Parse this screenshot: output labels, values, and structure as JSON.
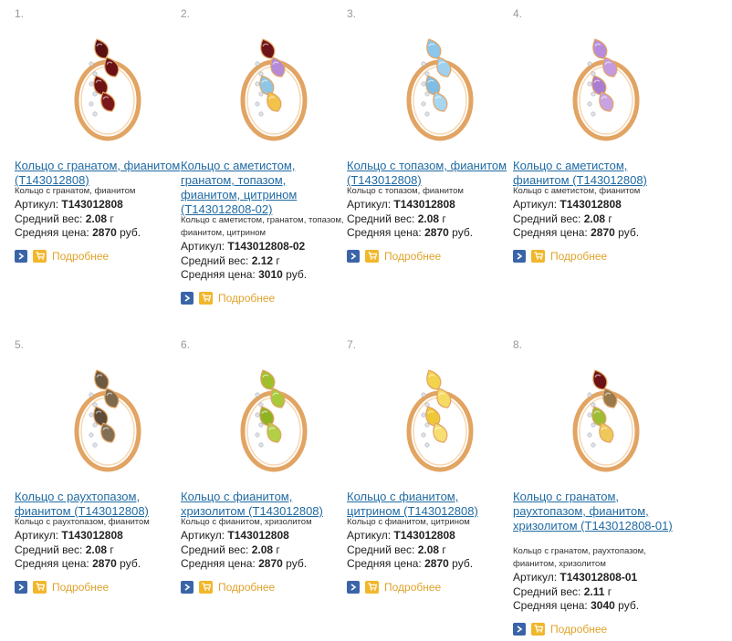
{
  "products": [
    {
      "number": "1.",
      "title": "Кольцо с гранатом, фианитом (Т143012808)",
      "description": "Кольцо с гранатом, фианитом",
      "article_label": "Артикул:",
      "article": "Т143012808",
      "weight_label": "Средний вес:",
      "weight": "2.08",
      "weight_unit": "г",
      "price_label": "Средняя цена:",
      "price": "2870",
      "price_unit": "руб.",
      "more_label": "Подробнее",
      "stones": [
        "#5a0f12",
        "#6b1115",
        "#6e1216",
        "#7b171a"
      ]
    },
    {
      "number": "2.",
      "title": "Кольцо с аметистом, гранатом, топазом, фианитом, цитрином (Т143012808-02)",
      "description": "Кольцо с аметистом, гранатом, топазом, фианитом, цитрином",
      "article_label": "Артикул:",
      "article": "Т143012808-02",
      "weight_label": "Средний вес:",
      "weight": "2.12",
      "weight_unit": "г",
      "price_label": "Средняя цена:",
      "price": "3010",
      "price_unit": "руб.",
      "more_label": "Подробнее",
      "stones": [
        "#6e1318",
        "#b58ad6",
        "#8fc6e6",
        "#f2c24a"
      ]
    },
    {
      "number": "3.",
      "title": "Кольцо с топазом, фианитом (Т143012808)",
      "description": "Кольцо с топазом, фианитом",
      "article_label": "Артикул:",
      "article": "Т143012808",
      "weight_label": "Средний вес:",
      "weight": "2.08",
      "weight_unit": "г",
      "price_label": "Средняя цена:",
      "price": "2870",
      "price_unit": "руб.",
      "more_label": "Подробнее",
      "stones": [
        "#8cc6ea",
        "#9fd1ef",
        "#7fbde6",
        "#a7d6f0"
      ]
    },
    {
      "number": "4.",
      "title": "Кольцо с аметистом, фианитом (Т143012808)",
      "description": "Кольцо с аметистом, фианитом",
      "article_label": "Артикул:",
      "article": "Т143012808",
      "weight_label": "Средний вес:",
      "weight": "2.08",
      "weight_unit": "г",
      "price_label": "Средняя цена:",
      "price": "2870",
      "price_unit": "руб.",
      "more_label": "Подробнее",
      "stones": [
        "#b78ddb",
        "#c49be0",
        "#a97dd2",
        "#c7a3e2"
      ]
    },
    {
      "number": "5.",
      "title": "Кольцо с раухтопазом, фианитом (Т143012808)",
      "description": "Кольцо с раухтопазом, фианитом",
      "article_label": "Артикул:",
      "article": "Т143012808",
      "weight_label": "Средний вес:",
      "weight": "2.08",
      "weight_unit": "г",
      "price_label": "Средняя цена:",
      "price": "2870",
      "price_unit": "руб.",
      "more_label": "Подробнее",
      "stones": [
        "#6d5a42",
        "#7d6a4f",
        "#5e4c38",
        "#826f55"
      ]
    },
    {
      "number": "6.",
      "title": "Кольцо с фианитом, хризолитом (Т143012808)",
      "description": "Кольцо с фианитом, хризолитом",
      "article_label": "Артикул:",
      "article": "Т143012808",
      "weight_label": "Средний вес:",
      "weight": "2.08",
      "weight_unit": "г",
      "price_label": "Средняя цена:",
      "price": "2870",
      "price_unit": "руб.",
      "more_label": "Подробнее",
      "stones": [
        "#9fbf2c",
        "#a9c93a",
        "#90b324",
        "#b2cf47"
      ]
    },
    {
      "number": "7.",
      "title": "Кольцо с фианитом, цитрином (Т143012808)",
      "description": "Кольцо с фианитом, цитрином",
      "article_label": "Артикул:",
      "article": "Т143012808",
      "weight_label": "Средний вес:",
      "weight": "2.08",
      "weight_unit": "г",
      "price_label": "Средняя цена:",
      "price": "2870",
      "price_unit": "руб.",
      "more_label": "Подробнее",
      "stones": [
        "#f3d24c",
        "#f5da63",
        "#eec838",
        "#f6de72"
      ]
    },
    {
      "number": "8.",
      "title": "Кольцо с гранатом, раухтопазом, фианитом, хризолитом (Т143012808-01)",
      "description": "Кольцо с гранатом, раухтопазом, фианитом, хризолитом",
      "article_label": "Артикул:",
      "article": "Т143012808-01",
      "weight_label": "Средний вес:",
      "weight": "2.11",
      "weight_unit": "г",
      "price_label": "Средняя цена:",
      "price": "3040",
      "price_unit": "руб.",
      "more_label": "Подробнее",
      "stones": [
        "#6b1216",
        "#9a7a4d",
        "#9cbd34",
        "#f0c85a"
      ]
    }
  ],
  "colors": {
    "link": "#1f6aa3",
    "more": "#e0a32a",
    "arrow_button": "#3a64a8",
    "cart_button": "#f1b72c",
    "gold": "#e2a463"
  }
}
